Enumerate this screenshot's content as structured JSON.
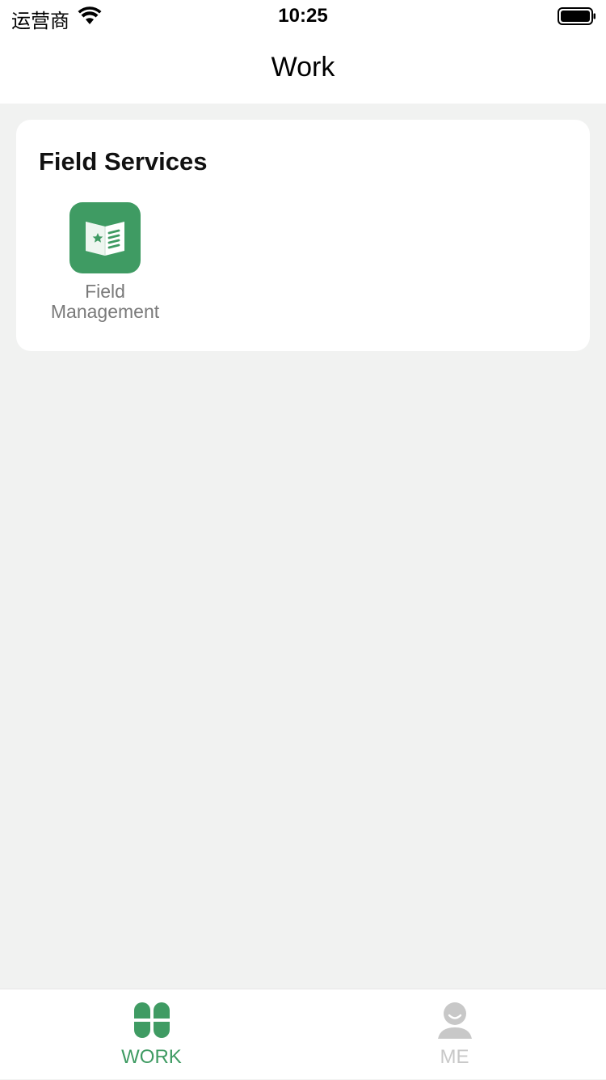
{
  "status_bar": {
    "carrier": "运营商",
    "time": "10:25",
    "icons": [
      "wifi-icon",
      "battery-icon"
    ]
  },
  "header": {
    "title": "Work"
  },
  "section": {
    "title": "Field Services",
    "apps": [
      {
        "label_line1": "Field",
        "label_line2": "Management",
        "icon": "book-star-icon",
        "color": "#3f9b63"
      }
    ]
  },
  "tab_bar": {
    "tabs": [
      {
        "label": "WORK",
        "icon": "clover-grid-icon",
        "active": true,
        "color": "#3f9b63"
      },
      {
        "label": "ME",
        "icon": "person-icon",
        "active": false,
        "color": "#c8c8c8"
      }
    ]
  },
  "colors": {
    "accent": "#3f9b63",
    "background": "#f1f2f1",
    "card": "#ffffff",
    "inactive": "#c8c8c8"
  }
}
